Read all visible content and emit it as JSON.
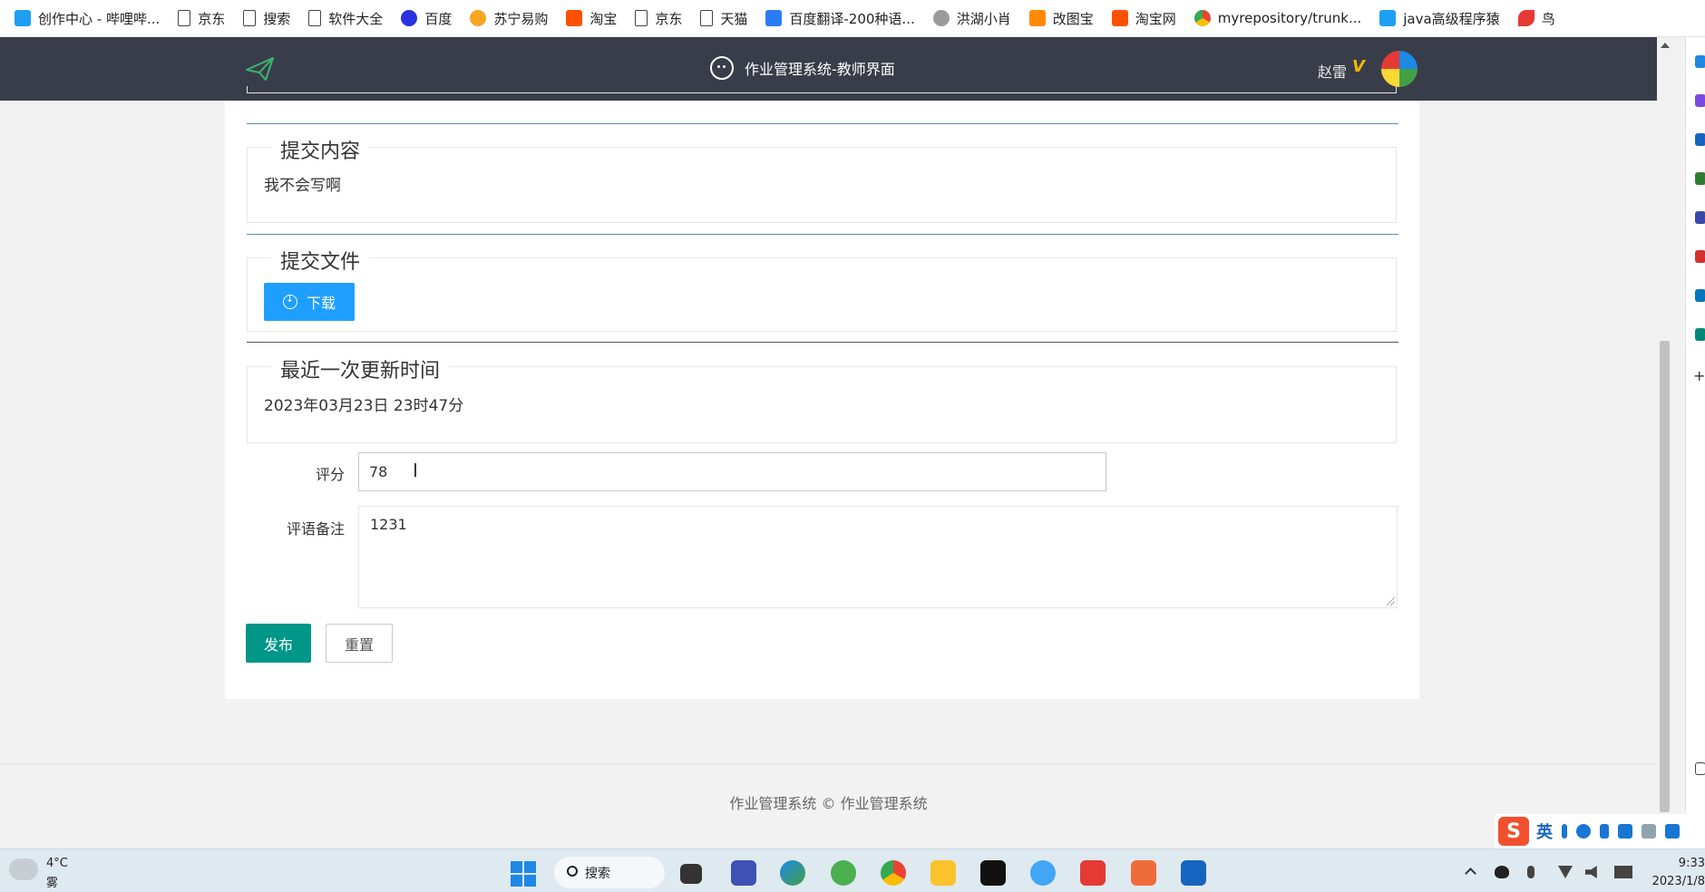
{
  "bookmarks": [
    {
      "label": "创作中心 - 哔哩哔...",
      "icon": "bilibili-icon"
    },
    {
      "label": "京东",
      "icon": "page-icon"
    },
    {
      "label": "搜索",
      "icon": "page-icon"
    },
    {
      "label": "软件大全",
      "icon": "page-icon"
    },
    {
      "label": "百度",
      "icon": "baidu-icon"
    },
    {
      "label": "苏宁易购",
      "icon": "suning-icon"
    },
    {
      "label": "淘宝",
      "icon": "taobao-icon"
    },
    {
      "label": "京东",
      "icon": "page-icon"
    },
    {
      "label": "天猫",
      "icon": "page-icon"
    },
    {
      "label": "百度翻译-200种语...",
      "icon": "translate-icon"
    },
    {
      "label": "洪湖小肖",
      "icon": "profile-icon"
    },
    {
      "label": "改图宝",
      "icon": "image-edit-icon"
    },
    {
      "label": "淘宝网",
      "icon": "taobao-icon"
    },
    {
      "label": "myrepository/trunk...",
      "icon": "chrome-icon"
    },
    {
      "label": "java高级程序猿",
      "icon": "bilibili-icon"
    },
    {
      "label": "鸟",
      "icon": "bird-icon"
    }
  ],
  "header": {
    "title": "作业管理系统-教师界面",
    "user_name": "赵雷",
    "vip_badge": "V"
  },
  "sections": {
    "content": {
      "legend": "提交内容",
      "text": "我不会写啊"
    },
    "file": {
      "legend": "提交文件",
      "download_label": "下载"
    },
    "update_time": {
      "legend": "最近一次更新时间",
      "text": "2023年03月23日 23时47分"
    }
  },
  "form": {
    "score_label": "评分",
    "score_value": "78",
    "remark_label": "评语备注",
    "remark_value": "1231",
    "publish_label": "发布",
    "reset_label": "重置"
  },
  "footer": {
    "text": "作业管理系统 ©  作业管理系统"
  },
  "ime": {
    "logo": "S",
    "mode": "英"
  },
  "taskbar": {
    "weather_temp": "4°C",
    "weather_desc": "雾",
    "search_label": "搜索",
    "time": "9:33",
    "date": "2023/1/8"
  },
  "colors": {
    "header_bg": "#393d49",
    "primary_blue": "#1e9fff",
    "publish_green": "#009688",
    "section_line_blue": "#5b8db8"
  }
}
